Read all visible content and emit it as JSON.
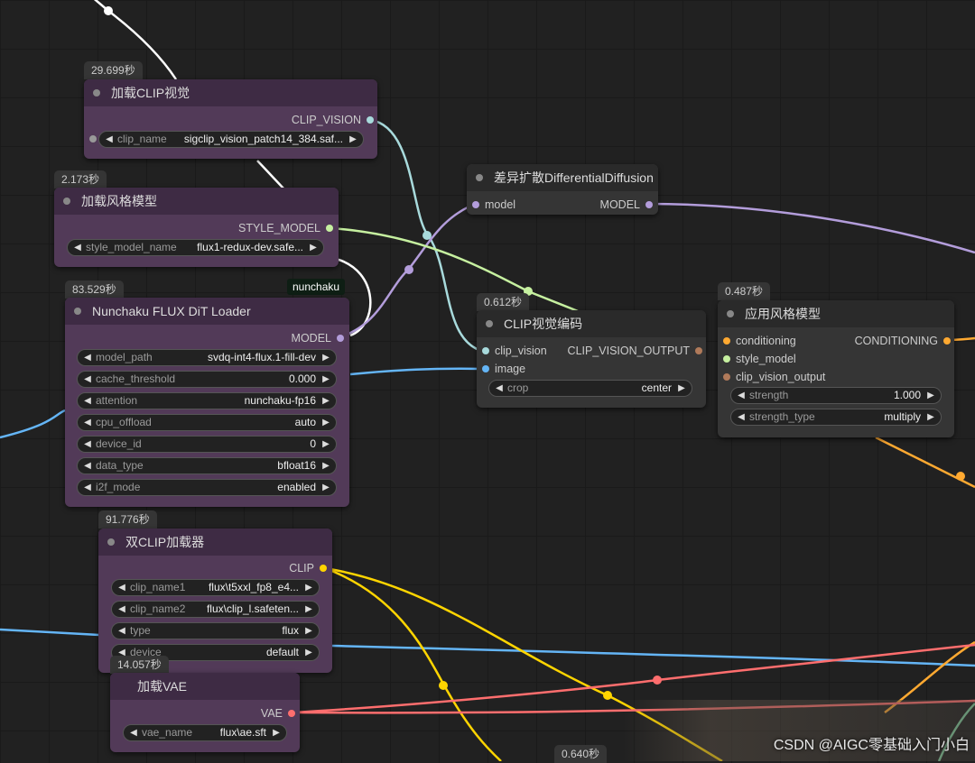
{
  "colors": {
    "canvas": "#212121",
    "wire_white": "#ffffff",
    "wire_clip_vision": "#a8dadc",
    "wire_model": "#b39ddb",
    "wire_style_model": "#c6f0a0",
    "wire_image": "#64b5f6",
    "wire_conditioning": "#ffa931",
    "wire_clip": "#ffd500",
    "wire_vae": "#ff6e6e"
  },
  "nodes": {
    "clip_vision_loader": {
      "time": "29.699秒",
      "title": "加载CLIP视觉",
      "output": "CLIP_VISION",
      "widgets": [
        {
          "label": "clip_name",
          "value": "sigclip_vision_patch14_384.saf..."
        }
      ]
    },
    "style_model_loader": {
      "time": "2.173秒",
      "title": "加载风格模型",
      "output": "STYLE_MODEL",
      "widgets": [
        {
          "label": "style_model_name",
          "value": "flux1-redux-dev.safe..."
        }
      ]
    },
    "nunchaku_loader": {
      "time": "83.529秒",
      "tag": "nunchaku",
      "title": "Nunchaku FLUX DiT Loader",
      "output": "MODEL",
      "widgets": [
        {
          "label": "model_path",
          "value": "svdq-int4-flux.1-fill-dev"
        },
        {
          "label": "cache_threshold",
          "value": "0.000"
        },
        {
          "label": "attention",
          "value": "nunchaku-fp16"
        },
        {
          "label": "cpu_offload",
          "value": "auto"
        },
        {
          "label": "device_id",
          "value": "0"
        },
        {
          "label": "data_type",
          "value": "bfloat16"
        },
        {
          "label": "i2f_mode",
          "value": "enabled"
        }
      ]
    },
    "dual_clip_loader": {
      "time": "91.776秒",
      "title": "双CLIP加载器",
      "output": "CLIP",
      "widgets": [
        {
          "label": "clip_name1",
          "value": "flux\\t5xxl_fp8_e4..."
        },
        {
          "label": "clip_name2",
          "value": "flux\\clip_l.safeten..."
        },
        {
          "label": "type",
          "value": "flux"
        },
        {
          "label": "device",
          "value": "default"
        }
      ]
    },
    "vae_loader": {
      "time": "14.057秒",
      "title": "加载VAE",
      "output": "VAE",
      "widgets": [
        {
          "label": "vae_name",
          "value": "flux\\ae.sft"
        }
      ]
    },
    "differential_diffusion": {
      "title": "差异扩散DifferentialDiffusion",
      "input": "model",
      "output": "MODEL"
    },
    "clip_vision_encode": {
      "time": "0.612秒",
      "title": "CLIP视觉编码",
      "inputs": [
        "clip_vision",
        "image"
      ],
      "output": "CLIP_VISION_OUTPUT",
      "widgets": [
        {
          "label": "crop",
          "value": "center"
        }
      ]
    },
    "apply_style_model": {
      "time": "0.487秒",
      "title": "应用风格模型",
      "inputs": [
        "conditioning",
        "style_model",
        "clip_vision_output"
      ],
      "output": "CONDITIONING",
      "widgets": [
        {
          "label": "strength",
          "value": "1.000"
        },
        {
          "label": "strength_type",
          "value": "multiply"
        }
      ]
    },
    "bottom_node": {
      "time": "0.640秒"
    }
  },
  "watermark": "CSDN @AIGC零基础入门小白"
}
